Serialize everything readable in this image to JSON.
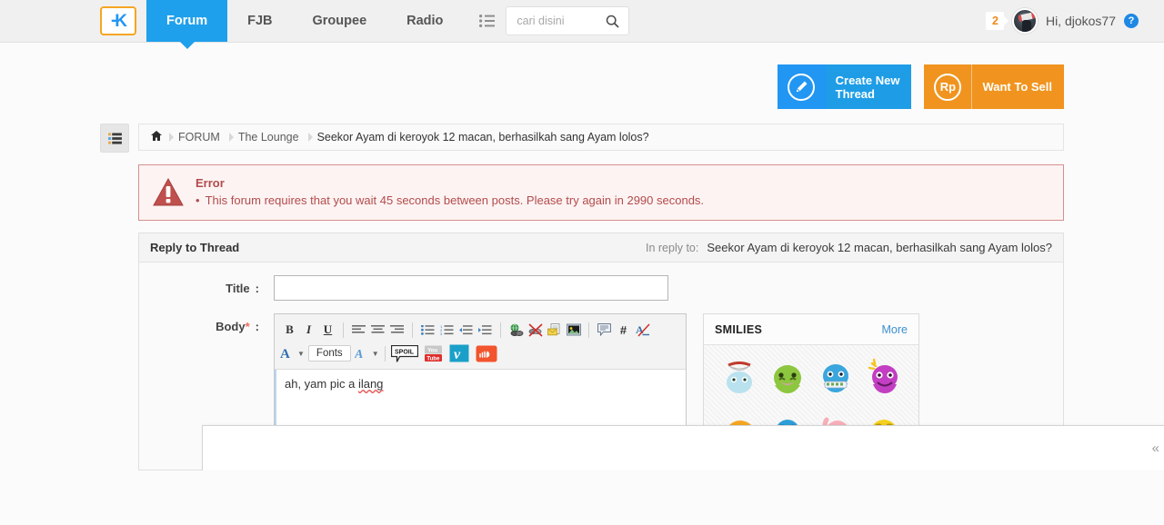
{
  "header": {
    "logo_label": "K",
    "nav_items": [
      {
        "label": "Forum",
        "active": true
      },
      {
        "label": "FJB",
        "active": false
      },
      {
        "label": "Groupee",
        "active": false
      },
      {
        "label": "Radio",
        "active": false
      }
    ],
    "menu_icon": "list-menu-icon",
    "search": {
      "placeholder": "cari disini",
      "value": "",
      "icon": "search-icon"
    },
    "notification_count": "2",
    "greeting": "Hi, djokos77",
    "help_icon_label": "?",
    "avatar_name": "user-avatar"
  },
  "actions": {
    "create_thread": {
      "label": "Create New\nThread",
      "line1": "Create New",
      "line2": "Thread",
      "icon": "pencil-icon",
      "color": "#2196f3"
    },
    "want_to_sell": {
      "label": "Want To Sell",
      "icon": "Rp",
      "color": "#f0941f"
    }
  },
  "breadcrumb": {
    "toggle_icon": "list-view-icon",
    "home_icon": "home-icon",
    "items": [
      {
        "label": "FORUM"
      },
      {
        "label": "The Lounge"
      },
      {
        "label": "Seekor Ayam di keroyok 12 macan, berhasilkah sang Ayam lolos?"
      }
    ]
  },
  "error": {
    "icon": "warning-triangle-icon",
    "title": "Error",
    "message": "This forum requires that you wait 45 seconds between posts. Please try again in 2990 seconds."
  },
  "reply_panel": {
    "title": "Reply to Thread",
    "in_reply_label": "In reply to:",
    "thread_title": "Seekor Ayam di keroyok 12 macan, berhasilkah sang Ayam lolos?",
    "title_field": {
      "label": "Title",
      "colon": ":",
      "value": "",
      "placeholder": ""
    },
    "body_field": {
      "label": "Body",
      "required_mark": "*",
      "colon": ":",
      "text_before": "ah, yam pic a ",
      "text_misspelled": "ilang"
    },
    "toolbar": {
      "row1": [
        {
          "name": "bold-icon",
          "glyph": "B"
        },
        {
          "name": "italic-icon",
          "glyph": "I"
        },
        {
          "name": "underline-icon",
          "glyph": "U"
        },
        {
          "name": "align-left-icon",
          "glyph": ""
        },
        {
          "name": "align-center-icon",
          "glyph": ""
        },
        {
          "name": "align-right-icon",
          "glyph": ""
        },
        {
          "name": "bullet-list-icon",
          "glyph": ""
        },
        {
          "name": "numbered-list-icon",
          "glyph": ""
        },
        {
          "name": "outdent-icon",
          "glyph": ""
        },
        {
          "name": "indent-icon",
          "glyph": ""
        },
        {
          "name": "insert-link-icon",
          "glyph": ""
        },
        {
          "name": "remove-link-icon",
          "glyph": ""
        },
        {
          "name": "insert-email-icon",
          "glyph": ""
        },
        {
          "name": "insert-image-icon",
          "glyph": ""
        },
        {
          "name": "insert-quote-icon",
          "glyph": ""
        },
        {
          "name": "insert-code-icon",
          "glyph": "#"
        },
        {
          "name": "remove-formatting-icon",
          "glyph": ""
        }
      ],
      "row2": [
        {
          "name": "font-color-icon",
          "glyph": "A"
        },
        {
          "name": "fonts-dropdown",
          "glyph": "Fonts"
        },
        {
          "name": "font-size-icon",
          "glyph": "A"
        },
        {
          "name": "spoiler-icon",
          "glyph": "SPOIL"
        },
        {
          "name": "youtube-icon",
          "glyph": "You Tube"
        },
        {
          "name": "vimeo-icon",
          "glyph": "v"
        },
        {
          "name": "soundcloud-icon",
          "glyph": ""
        }
      ],
      "fonts_label": "Fonts",
      "spoiler_label": "SPOIL",
      "youtube_label_top": "You",
      "youtube_label_bottom": "Tube",
      "vimeo_label": "v"
    }
  },
  "smilies": {
    "title": "SMILIES",
    "more_label": "More",
    "items": [
      {
        "name": "smiley-shy-white",
        "color": "#bfe4ee"
      },
      {
        "name": "smiley-sick-green",
        "color": "#8dc63f"
      },
      {
        "name": "smiley-money-mouth-blue",
        "color": "#3aa6dd"
      },
      {
        "name": "smiley-idea-purple",
        "color": "#c23ec2"
      },
      {
        "name": "smiley-laugh-orange",
        "color": "#f5a623"
      },
      {
        "name": "smiley-stare-blue",
        "color": "#2e9fd8"
      },
      {
        "name": "smiley-shy-pink",
        "color": "#f7afb8"
      },
      {
        "name": "smiley-worried-yellow",
        "color": "#f5d020"
      }
    ]
  },
  "bottom_bar": {
    "collapse_icon": "double-chevron-left-icon",
    "collapse_glyph": "«"
  }
}
